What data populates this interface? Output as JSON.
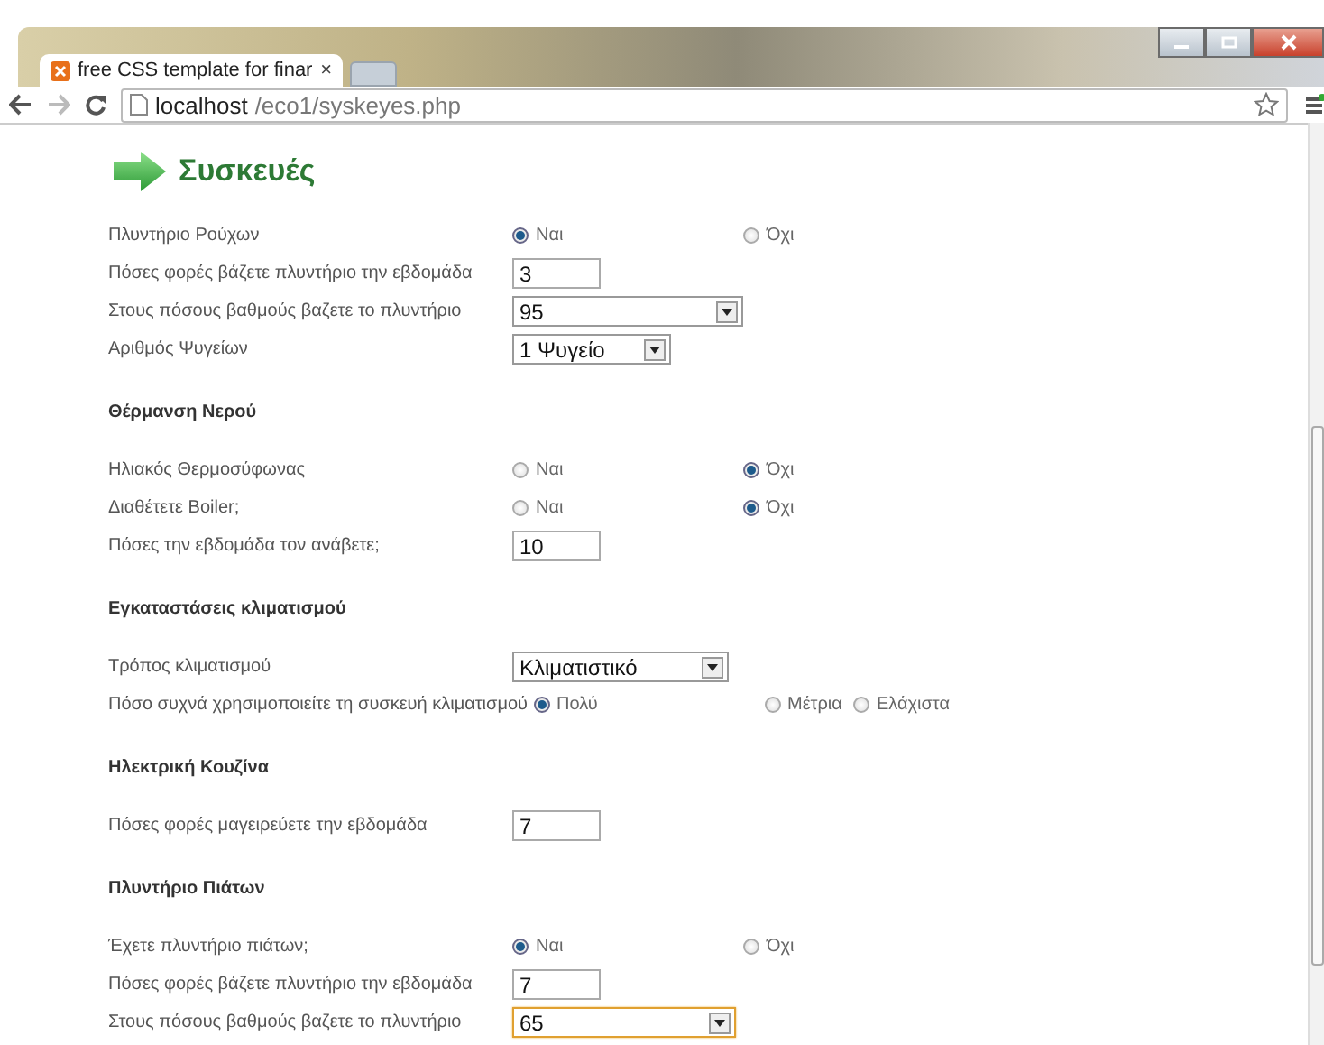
{
  "browser": {
    "tab": {
      "title": "free CSS template for finar",
      "close": "×"
    },
    "address": {
      "host": "localhost",
      "path": "/eco1/syskeyes.php"
    }
  },
  "page": {
    "heading": "Συσκευές",
    "rows": [
      {
        "kind": "radio",
        "label": "Πλυντήριο Ρούχων",
        "options": [
          {
            "label": "Ναι",
            "selected": true
          },
          {
            "label": "Όχι",
            "selected": false
          }
        ]
      },
      {
        "kind": "text",
        "label": "Πόσες φορές βάζετε πλυντήριο την εβδομάδα",
        "value": "3"
      },
      {
        "kind": "select",
        "label": "Στους πόσους βαθμούς βαζετε το πλυντήριο",
        "value": "95",
        "focused": false
      },
      {
        "kind": "select",
        "label": "Αριθμός Ψυγείων",
        "value": "1 Ψυγείο",
        "focused": false
      },
      {
        "kind": "section",
        "label": "Θέρμανση Νερού"
      },
      {
        "kind": "radio",
        "label": "Ηλιακός Θερμοσύφωνας",
        "options": [
          {
            "label": "Ναι",
            "selected": false
          },
          {
            "label": "Όχι",
            "selected": true
          }
        ]
      },
      {
        "kind": "radio",
        "label": "Διαθέτετε Boiler;",
        "options": [
          {
            "label": "Ναι",
            "selected": false
          },
          {
            "label": "Όχι",
            "selected": true
          }
        ]
      },
      {
        "kind": "text",
        "label": "Πόσες την εβδομάδα τον ανάβετε;",
        "value": "10"
      },
      {
        "kind": "section",
        "label": "Εγκαταστάσεις κλιματισμού"
      },
      {
        "kind": "select",
        "label": "Τρόπος κλιματισμού",
        "value": "Κλιματιστικό",
        "focused": false
      },
      {
        "kind": "radio",
        "label": "Πόσο συχνά χρησιμοποιείτε τη συσκευή κλιματισμού",
        "options": [
          {
            "label": "Πολύ",
            "selected": true
          },
          {
            "label": "Μέτρια",
            "selected": false
          },
          {
            "label": "Ελάχιστα",
            "selected": false
          }
        ]
      },
      {
        "kind": "section",
        "label": "Ηλεκτρική Κουζίνα"
      },
      {
        "kind": "text",
        "label": "Πόσες φορές μαγειρεύετε την εβδομάδα",
        "value": "7"
      },
      {
        "kind": "section",
        "label": "Πλυντήριο Πιάτων"
      },
      {
        "kind": "radio",
        "label": "Έχετε πλυντήριο πιάτων;",
        "options": [
          {
            "label": "Ναι",
            "selected": true
          },
          {
            "label": "Όχι",
            "selected": false
          }
        ]
      },
      {
        "kind": "text",
        "label": "Πόσες φορές βάζετε πλυντήριο την εβδομάδα",
        "value": "7"
      },
      {
        "kind": "select",
        "label": "Στους πόσους βαθμούς βαζετε το πλυντήριο",
        "value": "65",
        "focused": true
      }
    ]
  }
}
